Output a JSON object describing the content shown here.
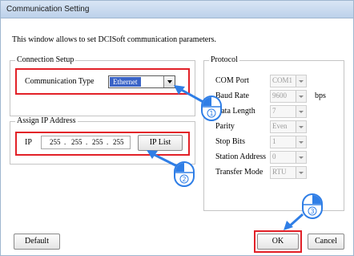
{
  "window": {
    "title": "Communication Setting"
  },
  "description": "This window allows to set DCISoft communication parameters.",
  "connection_setup": {
    "label": "Connection Setup",
    "type_label": "Communication Type",
    "type_value": "Ethernet"
  },
  "assign_ip": {
    "label": "Assign IP Address",
    "ip_label": "IP",
    "octets": [
      "255",
      "255",
      "255",
      "255"
    ],
    "ip_list_button": "IP List"
  },
  "protocol": {
    "label": "Protocol",
    "fields": [
      {
        "label": "COM Port",
        "value": "COM1",
        "unit": ""
      },
      {
        "label": "Baud Rate",
        "value": "9600",
        "unit": "bps"
      },
      {
        "label": "Data Length",
        "value": "7",
        "unit": ""
      },
      {
        "label": "Parity",
        "value": "Even",
        "unit": ""
      },
      {
        "label": "Stop Bits",
        "value": "1",
        "unit": ""
      },
      {
        "label": "Station Address",
        "value": "0",
        "unit": ""
      },
      {
        "label": "Transfer Mode",
        "value": "RTU",
        "unit": ""
      }
    ]
  },
  "buttons": {
    "default": "Default",
    "ok": "OK",
    "cancel": "Cancel"
  },
  "markers": [
    "1",
    "2",
    "3"
  ],
  "colors": {
    "highlight": "#e22128",
    "marker_blue": "#2f7ee6",
    "selection": "#3a63c7"
  }
}
